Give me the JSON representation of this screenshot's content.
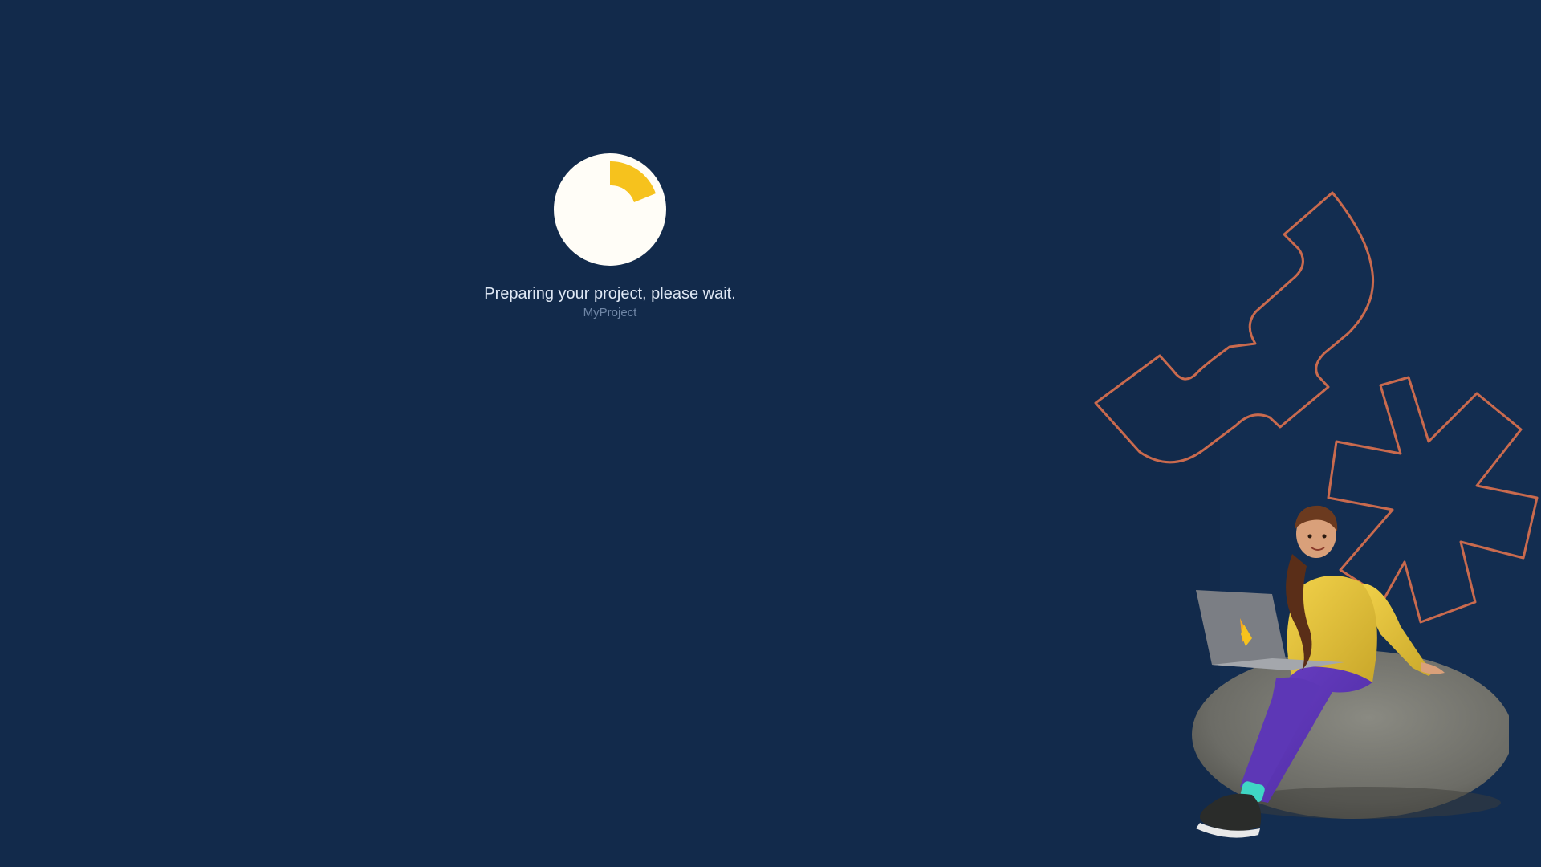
{
  "status": {
    "message": "Preparing your project, please wait.",
    "project_name": "MyProject"
  },
  "loader": {
    "icon": "progress-spinner-icon",
    "fill_color": "#fffdf7",
    "accent_color": "#f6c21d"
  },
  "illustration": {
    "icon": "person-with-laptop-illustration",
    "decor_color": "#c96a4e"
  },
  "theme": {
    "background": "#122a4b",
    "panel": "#132d50",
    "text": "#dfe8f5",
    "subtext": "#6f86a6"
  }
}
